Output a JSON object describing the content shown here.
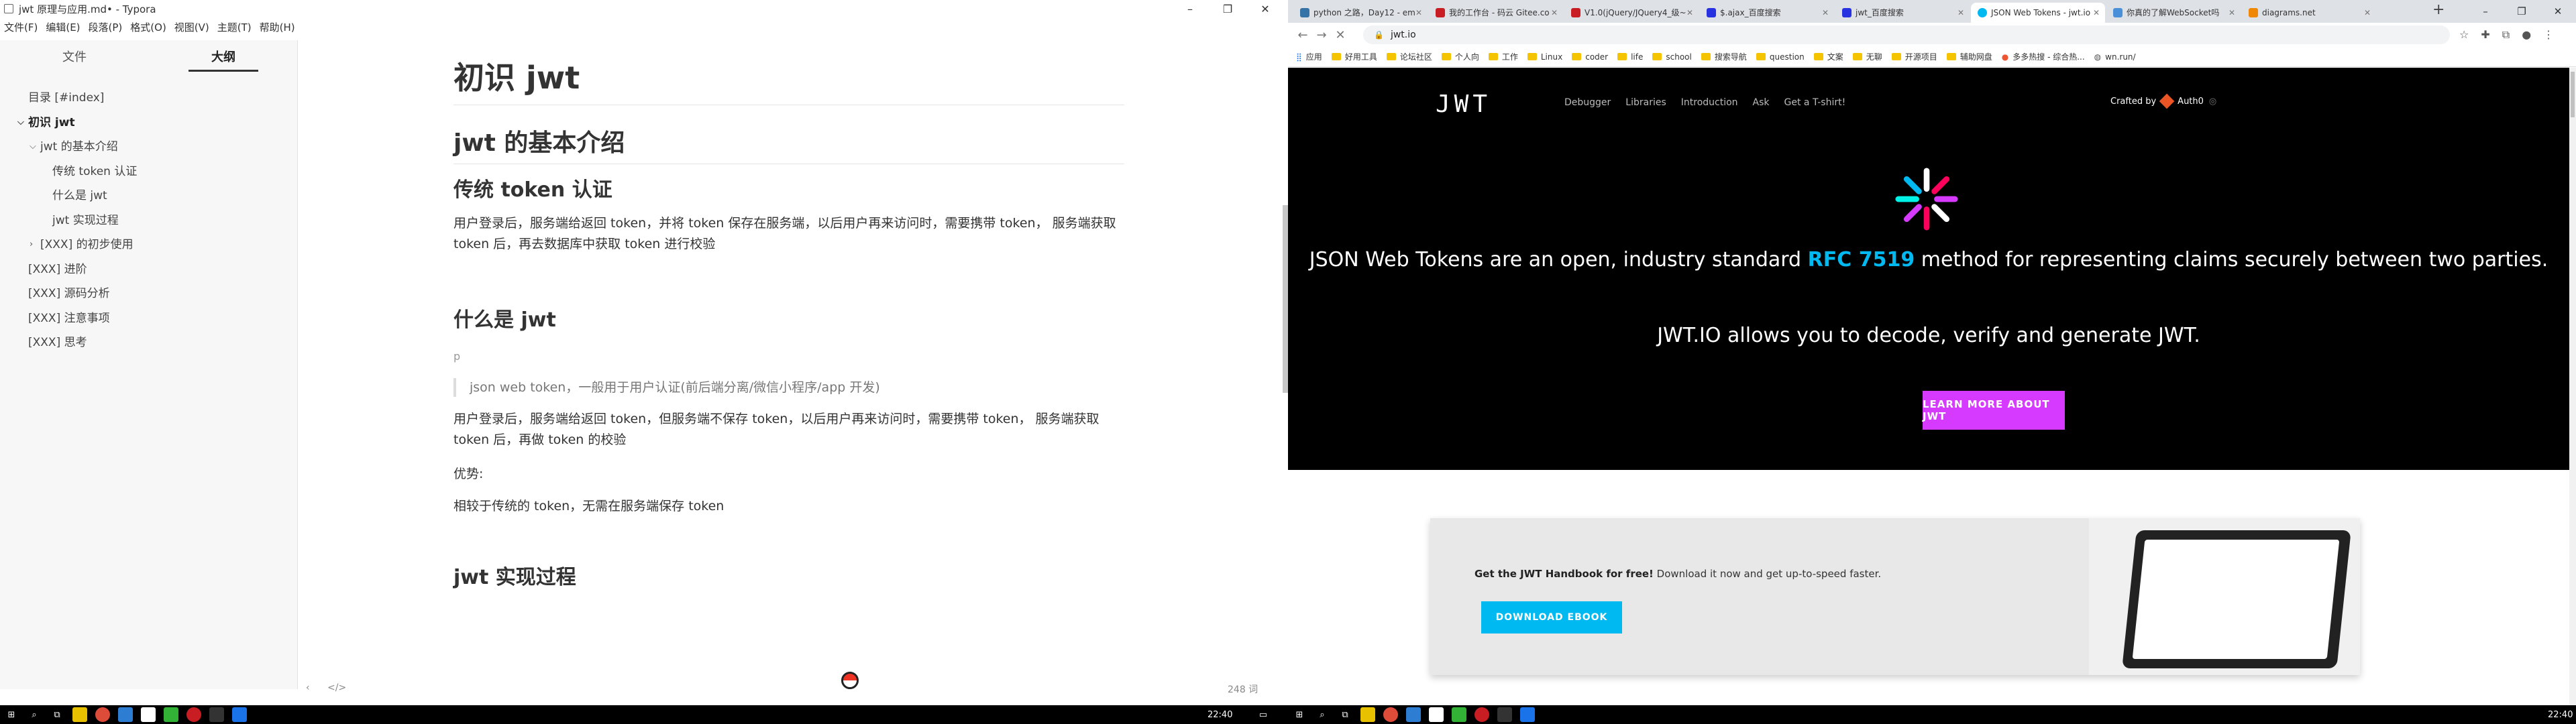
{
  "typora": {
    "window_title": "jwt 原理与应用.md• - Typora",
    "menu": [
      "文件(F)",
      "编辑(E)",
      "段落(P)",
      "格式(O)",
      "视图(V)",
      "主题(T)",
      "帮助(H)"
    ],
    "sidebar_tabs": [
      "文件",
      "大纲"
    ],
    "outline": [
      {
        "label": "目录 [#index]"
      },
      {
        "label": "初识 jwt"
      },
      {
        "label": "jwt 的基本介绍"
      },
      {
        "label": "传统 token 认证"
      },
      {
        "label": "什么是 jwt"
      },
      {
        "label": "jwt 实现过程"
      },
      {
        "label": "[XXX] 的初步使用"
      },
      {
        "label": "[XXX] 进阶"
      },
      {
        "label": "[XXX] 源码分析"
      },
      {
        "label": "[XXX] 注意事项"
      },
      {
        "label": "[XXX] 思考"
      }
    ],
    "doc": {
      "h1": "初识 jwt",
      "h2": "jwt 的基本介绍",
      "h3_traditional": "传统 token 认证",
      "p_traditional": "用户登录后，服务端给返回 token，并将 token 保存在服务端，以后用户再来访问时，需要携带 token， 服务端获取 token 后，再去数据库中获取 token 进行校验",
      "h3_what": "什么是 jwt",
      "cursor_text": "p",
      "quote": "json web token，一般用于用户认证(前后端分离/微信小程序/app 开发)",
      "p_jwt": "用户登录后，服务端给返回 token，但服务端不保存 token，以后用户再来访问时，需要携带 token， 服务端获取 token 后，再做 token 的校验",
      "advantage_label": "优势:",
      "advantage_text": "相较于传统的 token，无需在服务端保存 token",
      "h3_impl": "jwt 实现过程"
    },
    "footer_left": "< </>",
    "word_count": "248 词"
  },
  "chrome": {
    "tabs": [
      {
        "title": "python 之路，Day12 - em",
        "color": "#3572a5"
      },
      {
        "title": "我的工作台 - 码云 Gitee.co",
        "color": "#c71d23"
      },
      {
        "title": "V1.0(jQuery/JQuery4_级~",
        "color": "#c71d23"
      },
      {
        "title": "$.ajax_百度搜索",
        "color": "#2932e1"
      },
      {
        "title": "jwt_百度搜索",
        "color": "#2932e1"
      },
      {
        "title": "JSON Web Tokens - jwt.io",
        "color": "#00b9f1"
      },
      {
        "title": "你真的了解WebSocket吗",
        "color": "#4a90d9"
      },
      {
        "title": "diagrams.net",
        "color": "#f08705"
      }
    ],
    "active_tab": 5,
    "url": "jwt.io",
    "bookmarks": [
      "应用",
      "好用工具",
      "论坛社区",
      "个人向",
      "工作",
      "Linux",
      "coder",
      "life",
      "school",
      "搜索导航",
      "question",
      "文案",
      "无聊",
      "开源项目",
      "辅助网盘",
      "多多热搜 - 综合热...",
      "wn.run/"
    ]
  },
  "jwt_page": {
    "logo": "JWT",
    "nav": [
      "Debugger",
      "Libraries",
      "Introduction",
      "Ask",
      "Get a T-shirt!"
    ],
    "crafted_by": "Crafted by",
    "auth0": "Auth0",
    "headline_pre": "JSON Web Tokens are an open, industry standard ",
    "headline_rfc": "RFC 7519",
    "headline_post": " method for representing claims securely between two parties.",
    "subheadline": "JWT.IO allows you to decode, verify and generate JWT.",
    "learn_button": "LEARN MORE ABOUT JWT",
    "ebook_bold": "Get the JWT Handbook for free!",
    "ebook_text": " Download it now and get up-to-speed faster.",
    "download_button": "DOWNLOAD EBOOK"
  },
  "taskbar": {
    "left_time": "22:40",
    "right_time": "22:40"
  }
}
